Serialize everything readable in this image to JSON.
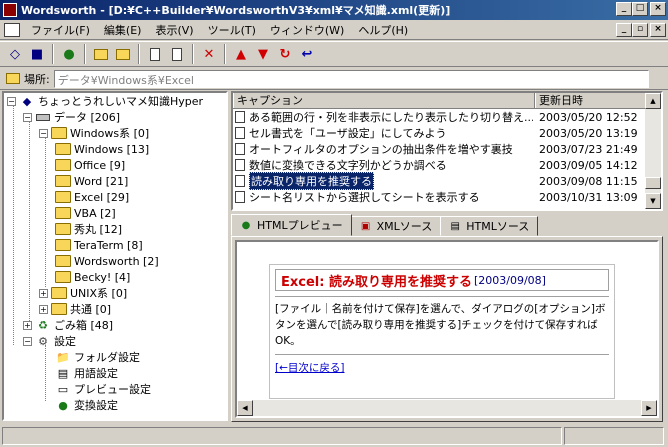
{
  "window": {
    "title": "Wordsworth - [D:¥C++Builder¥WordsworthV3¥xml¥マメ知識.xml(更新)]"
  },
  "menu": [
    "ファイル(F)",
    "編集(E)",
    "表示(V)",
    "ツール(T)",
    "ウィンドウ(W)",
    "ヘルプ(H)"
  ],
  "location": {
    "label": "場所:",
    "value": "データ¥Windows系¥Excel"
  },
  "tree": {
    "root": "ちょっとうれしいマメ知識Hyper",
    "data": "データ [206]",
    "windows": "Windows系 [0]",
    "children": [
      "Windows [13]",
      "Office [9]",
      "Word [21]",
      "Excel [29]",
      "VBA [2]",
      "秀丸 [12]",
      "TeraTerm [8]",
      "Wordsworth [2]",
      "Becky! [4]"
    ],
    "unix": "UNIX系 [0]",
    "common": "共通 [0]",
    "trash": "ごみ箱 [48]",
    "settings": "設定",
    "settings_items": [
      "フォルダ設定",
      "用語設定",
      "プレビュー設定",
      "変換設定"
    ]
  },
  "list": {
    "columns": [
      "キャプション",
      "更新日時"
    ],
    "rows": [
      {
        "caption": "ある範囲の行・列を非表示にしたり表示したり切り替え...",
        "date": "2003/05/20 12:52"
      },
      {
        "caption": "セル書式を「ユーザ設定」にしてみよう",
        "date": "2003/05/20 13:19"
      },
      {
        "caption": "オートフィルタのオプションの抽出条件を増やす裏技",
        "date": "2003/07/23 21:49"
      },
      {
        "caption": "数値に変換できる文字列かどうか調べる",
        "date": "2003/09/05 14:12"
      },
      {
        "caption": "読み取り専用を推奨する",
        "date": "2003/09/08 11:15"
      },
      {
        "caption": "シート名リストから選択してシートを表示する",
        "date": "2003/10/31 13:09"
      }
    ],
    "selected_index": 4
  },
  "tabs": [
    "HTMLプレビュー",
    "XMLソース",
    "HTMLソース"
  ],
  "preview": {
    "heading": "Excel: 読み取り専用を推奨する",
    "date": "[2003/09/08]",
    "body": "[ファイル｜名前を付けて保存]を選んで、ダイアログの[オプション]ボタンを選んで[読み取り専用を推奨する]チェックを付けて保存すればOK。",
    "link": "[←目次に戻る]"
  }
}
